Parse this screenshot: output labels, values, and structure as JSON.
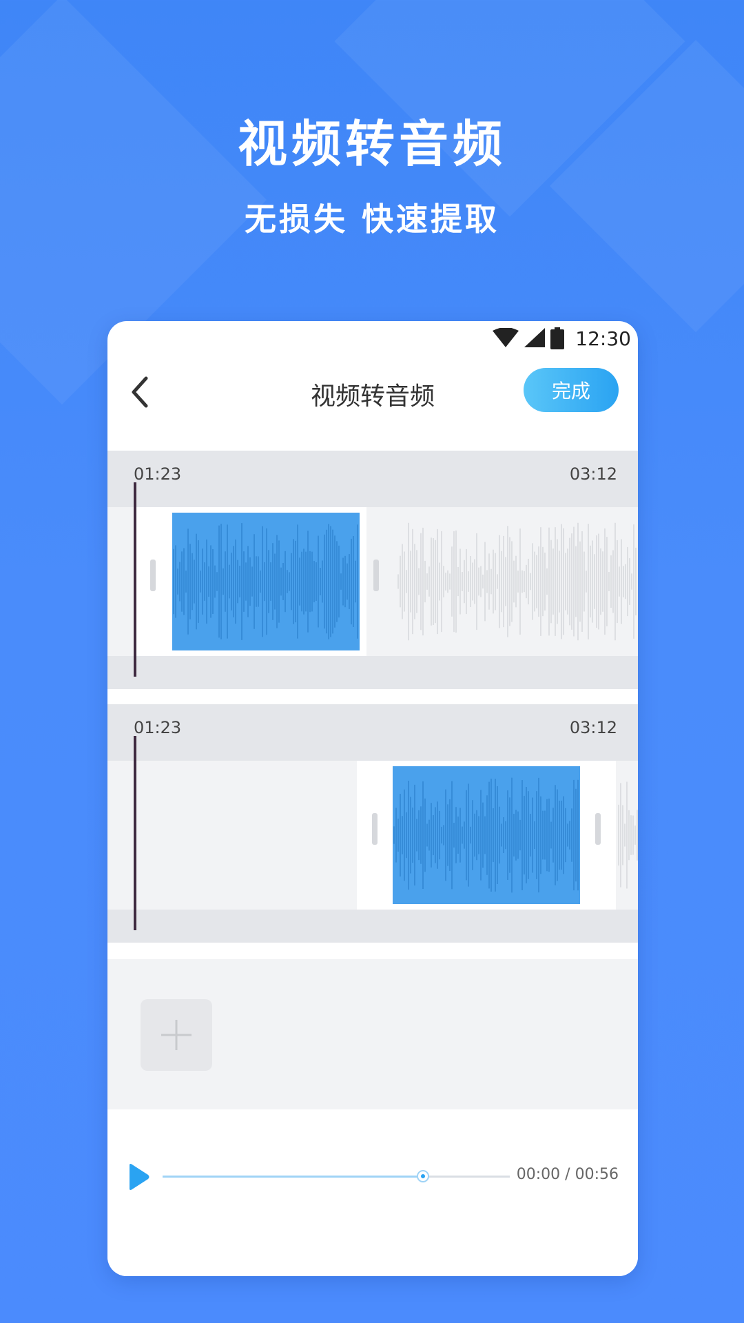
{
  "hero": {
    "title": "视频转音频",
    "subtitle": "无损失 快速提取"
  },
  "status_bar": {
    "time": "12:30",
    "icons": [
      "wifi-icon",
      "signal-icon",
      "battery-icon"
    ]
  },
  "nav": {
    "back_icon": "chevron-left-icon",
    "title": "视频转音频",
    "done_label": "完成"
  },
  "tracks": [
    {
      "start_time": "01:23",
      "end_time": "03:12"
    },
    {
      "start_time": "01:23",
      "end_time": "03:12"
    }
  ],
  "add_button_icon": "plus-icon",
  "player": {
    "play_icon": "play-icon",
    "current_time": "00:00",
    "separator": "/",
    "total_time": "00:56",
    "progress_fraction": 0.75
  },
  "colors": {
    "background": "#4a8cfb",
    "accent": "#2aa3f2",
    "selected_clip": "#4aa1ec",
    "playhead": "#3e2a40"
  }
}
